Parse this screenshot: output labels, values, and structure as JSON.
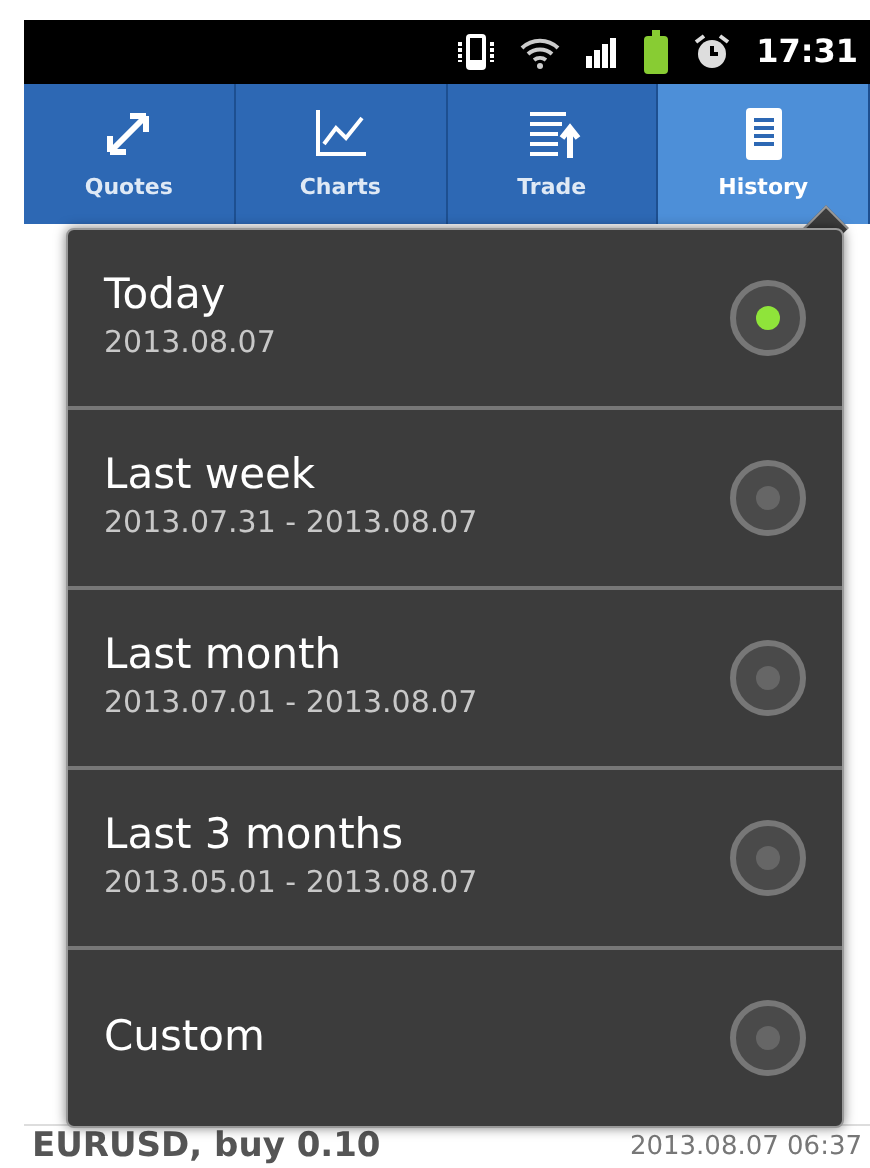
{
  "status_bar": {
    "time": "17:31"
  },
  "tabs": [
    {
      "label": "Quotes",
      "kind": "quotes",
      "selected": false
    },
    {
      "label": "Charts",
      "kind": "charts",
      "selected": false
    },
    {
      "label": "Trade",
      "kind": "trade",
      "selected": false
    },
    {
      "label": "History",
      "kind": "history",
      "selected": true
    }
  ],
  "period_menu": [
    {
      "label": "Today",
      "range": "2013.08.07",
      "selected": true
    },
    {
      "label": "Last week",
      "range": "2013.07.31 - 2013.08.07",
      "selected": false
    },
    {
      "label": "Last month",
      "range": "2013.07.01 - 2013.08.07",
      "selected": false
    },
    {
      "label": "Last 3 months",
      "range": "2013.05.01 - 2013.08.07",
      "selected": false
    },
    {
      "label": "Custom",
      "selected": false
    }
  ],
  "deals": [
    {
      "symbol": "EURUSD, buy 0.10",
      "time": "2013.08.07 06:37"
    }
  ]
}
